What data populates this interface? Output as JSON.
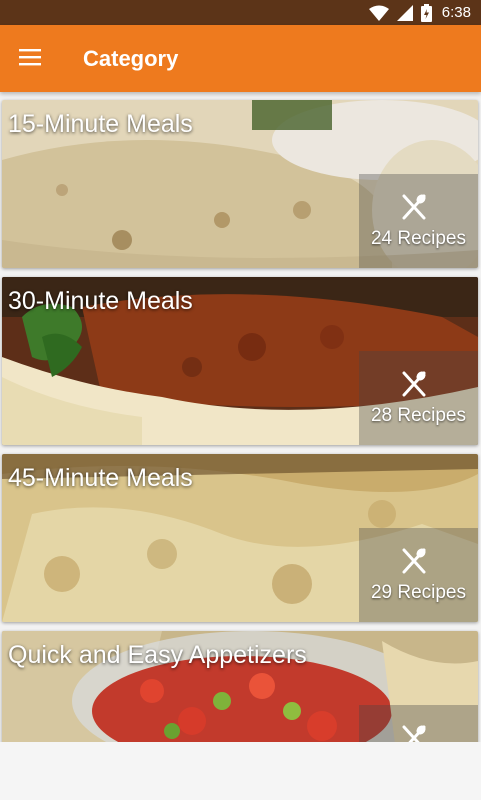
{
  "status_bar": {
    "time": "6:38"
  },
  "app_bar": {
    "title": "Category",
    "menu_icon": "hamburger-menu-icon"
  },
  "categories": [
    {
      "title": "15-Minute Meals",
      "count": "24 Recipes"
    },
    {
      "title": "30-Minute Meals",
      "count": "28 Recipes"
    },
    {
      "title": "45-Minute Meals",
      "count": "29 Recipes"
    },
    {
      "title": "Quick and Easy Appetizers",
      "count": ""
    }
  ],
  "colors": {
    "status_bar": "#5c3418",
    "app_bar": "#ee7a1e",
    "accent_text": "#ffffff"
  }
}
